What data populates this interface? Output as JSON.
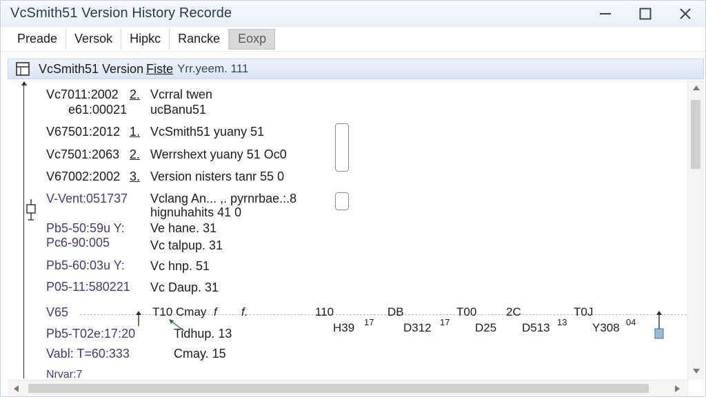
{
  "window": {
    "title": "VcSmith51 Version History Recorde"
  },
  "toolbar": {
    "tabs": [
      {
        "label": "Preade"
      },
      {
        "label": "Versok"
      },
      {
        "label": "Hipkc"
      },
      {
        "label": "Rancke"
      },
      {
        "label": "Eoxp"
      }
    ]
  },
  "panel": {
    "title": "VcSmith51 Version",
    "title_underlined": "Fiste",
    "subtitle": "Yrr.yeem. 111"
  },
  "rows": [
    {
      "id": "Vc7011:2002",
      "num": "2.",
      "desc": "Vcrral twen"
    },
    {
      "id": "e61:00021",
      "num": "",
      "desc": "ucBanu51"
    },
    {
      "id": "V67501:2012",
      "num": "1.",
      "desc": "VcSmith51 yuany 51"
    },
    {
      "id": "Vc7501:2063",
      "num": "2.",
      "desc": "Werrshext yuany 51 Oc0"
    },
    {
      "id": "V67002:2002",
      "num": "3.",
      "desc": "Version nisters tanr 55 0"
    },
    {
      "id": "V-Vent:051737",
      "num": "",
      "desc": "Vclang An... ,. pyrnrbae.:.8"
    },
    {
      "id": "",
      "num": "",
      "desc": "hignuhahits 41 0"
    },
    {
      "id": "Pb5-50:59u Y:",
      "num": "",
      "desc": "Ve hane. 31"
    },
    {
      "id": "Pc6-90:005",
      "num": "",
      "desc": "Vc talpup. 31"
    },
    {
      "id": "Pb5-60:03u Y:",
      "num": "",
      "desc": "Vc hnp. 51"
    },
    {
      "id": "P05-11:580221",
      "num": "",
      "desc": "Vc Daup. 31"
    }
  ],
  "timeline": {
    "row_label": "V65",
    "start_label": "T10 Cmay",
    "f1": "f",
    "f2": "f.",
    "marks": [
      "110",
      "DB",
      "T00",
      "2C",
      "T0J"
    ],
    "bottom_marks": [
      {
        "label": "H39",
        "sup": "17"
      },
      {
        "label": "D312",
        "sup": "17"
      },
      {
        "label": "D25",
        "sup": ""
      },
      {
        "label": "D513",
        "sup": "13"
      },
      {
        "label": "Y308",
        "sup": "04"
      }
    ]
  },
  "lower_rows": [
    {
      "id": "Pb5-T02e:17:20",
      "desc": "Tidhup. 13"
    },
    {
      "id": "Vabl: T=60:333",
      "desc": "Cmay. 15"
    },
    {
      "id": "Nrvar:7",
      "desc": ""
    }
  ],
  "icons": {
    "window_minimize": "minimize-icon",
    "window_maximize": "maximize-icon",
    "window_close": "close-icon",
    "panel": "panel-icon"
  }
}
